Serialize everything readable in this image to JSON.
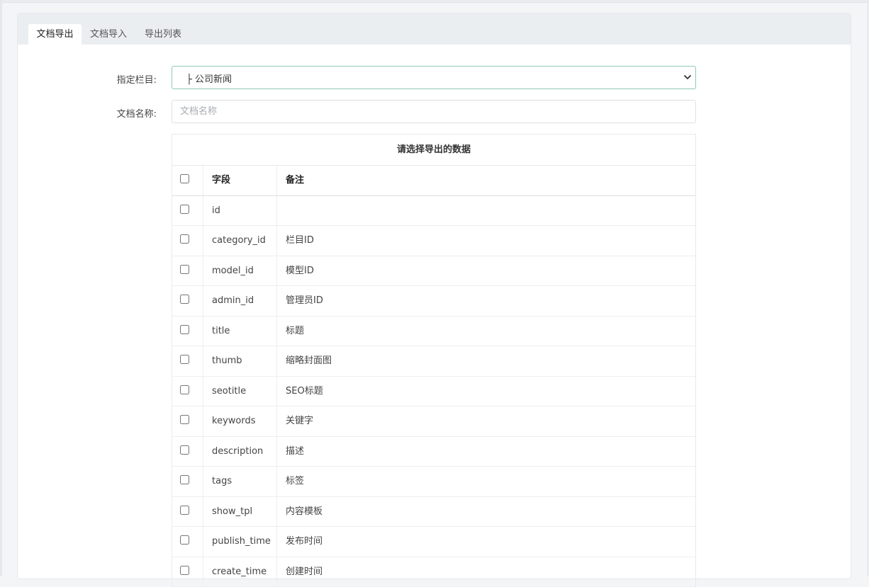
{
  "tabs": [
    {
      "label": "文档导出",
      "active": true
    },
    {
      "label": "文档导入",
      "active": false
    },
    {
      "label": "导出列表",
      "active": false
    }
  ],
  "form": {
    "category_label": "指定栏目:",
    "category_value": "├ 公司新闻",
    "name_label": "文档名称:",
    "name_placeholder": "文档名称",
    "name_value": ""
  },
  "table": {
    "caption": "请选择导出的数据",
    "headers": {
      "field": "字段",
      "note": "备注"
    },
    "rows": [
      {
        "field": "id",
        "note": ""
      },
      {
        "field": "category_id",
        "note": "栏目ID"
      },
      {
        "field": "model_id",
        "note": "模型ID"
      },
      {
        "field": "admin_id",
        "note": "管理员ID"
      },
      {
        "field": "title",
        "note": "标题"
      },
      {
        "field": "thumb",
        "note": "缩略封面图"
      },
      {
        "field": "seotitle",
        "note": "SEO标题"
      },
      {
        "field": "keywords",
        "note": "关键字"
      },
      {
        "field": "description",
        "note": "描述"
      },
      {
        "field": "tags",
        "note": "标签"
      },
      {
        "field": "show_tpl",
        "note": "内容模板"
      },
      {
        "field": "publish_time",
        "note": "发布时间"
      },
      {
        "field": "create_time",
        "note": "创建时间"
      }
    ]
  },
  "colors": {
    "accent_border": "#8fc7b9",
    "tabbar_bg": "#ebeef1"
  }
}
